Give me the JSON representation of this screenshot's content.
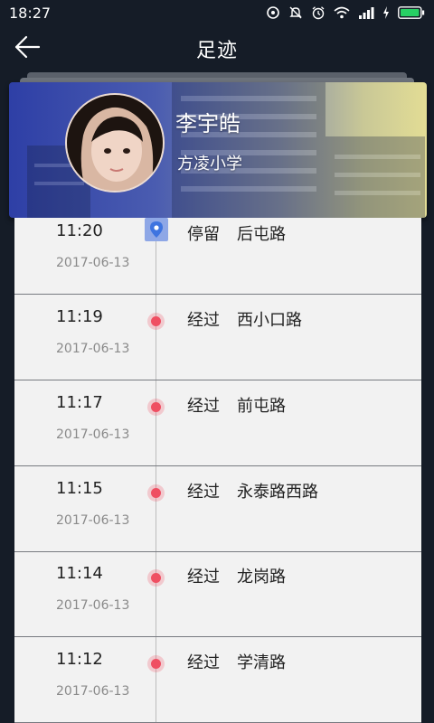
{
  "status_bar": {
    "time": "18:27",
    "icons": [
      "hotspot-icon",
      "mute-icon",
      "alarm-icon",
      "wifi-icon",
      "signal-icon",
      "charging-icon",
      "battery-icon"
    ]
  },
  "nav": {
    "title": "足迹",
    "back_icon": "arrow-left-icon"
  },
  "profile": {
    "name": "李宇皓",
    "school": "方凌小学"
  },
  "timeline": [
    {
      "time": "11:20",
      "date": "2017-06-13",
      "action": "停留",
      "road": "后屯路",
      "marker": "pin"
    },
    {
      "time": "11:19",
      "date": "2017-06-13",
      "action": "经过",
      "road": "西小口路",
      "marker": "dot"
    },
    {
      "time": "11:17",
      "date": "2017-06-13",
      "action": "经过",
      "road": "前屯路",
      "marker": "dot"
    },
    {
      "time": "11:15",
      "date": "2017-06-13",
      "action": "经过",
      "road": "永泰路西路",
      "marker": "dot"
    },
    {
      "time": "11:14",
      "date": "2017-06-13",
      "action": "经过",
      "road": "龙岗路",
      "marker": "dot"
    },
    {
      "time": "11:12",
      "date": "2017-06-13",
      "action": "经过",
      "road": "学清路",
      "marker": "dot"
    }
  ],
  "colors": {
    "background": "#151c27",
    "list_background": "#f2f2f2",
    "pass_dot": "#ef4f62",
    "stay_pin": "#8ea7e6"
  }
}
